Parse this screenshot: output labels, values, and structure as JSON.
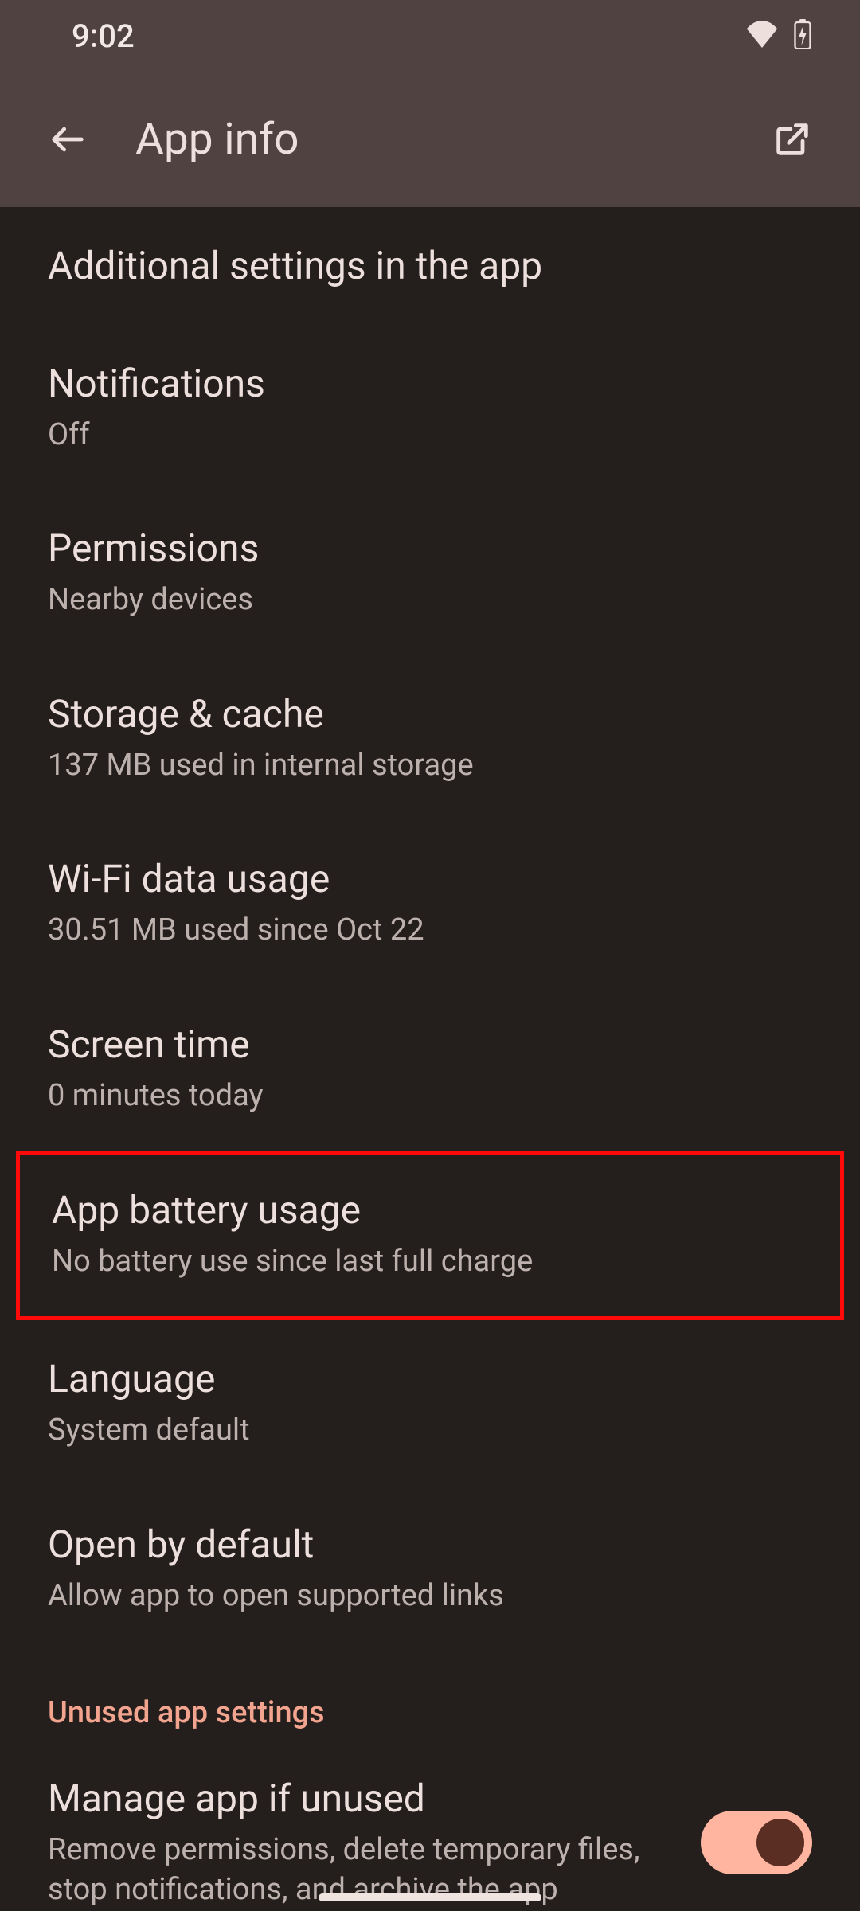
{
  "status": {
    "time": "9:02"
  },
  "header": {
    "title": "App info"
  },
  "items": {
    "additional": {
      "title": "Additional settings in the app"
    },
    "notifications": {
      "title": "Notifications",
      "sub": "Off"
    },
    "permissions": {
      "title": "Permissions",
      "sub": "Nearby devices"
    },
    "storage": {
      "title": "Storage & cache",
      "sub": "137 MB used in internal storage"
    },
    "wifi": {
      "title": "Wi-Fi data usage",
      "sub": "30.51 MB used since Oct 22"
    },
    "screentime": {
      "title": "Screen time",
      "sub": "0 minutes today"
    },
    "battery": {
      "title": "App battery usage",
      "sub": "No battery use since last full charge"
    },
    "language": {
      "title": "Language",
      "sub": "System default"
    },
    "openby": {
      "title": "Open by default",
      "sub": "Allow app to open supported links"
    }
  },
  "section": {
    "unused_header": "Unused app settings",
    "manage_unused": {
      "title": "Manage app if unused",
      "sub": "Remove permissions, delete temporary files, stop notifications, and archive the app"
    }
  }
}
